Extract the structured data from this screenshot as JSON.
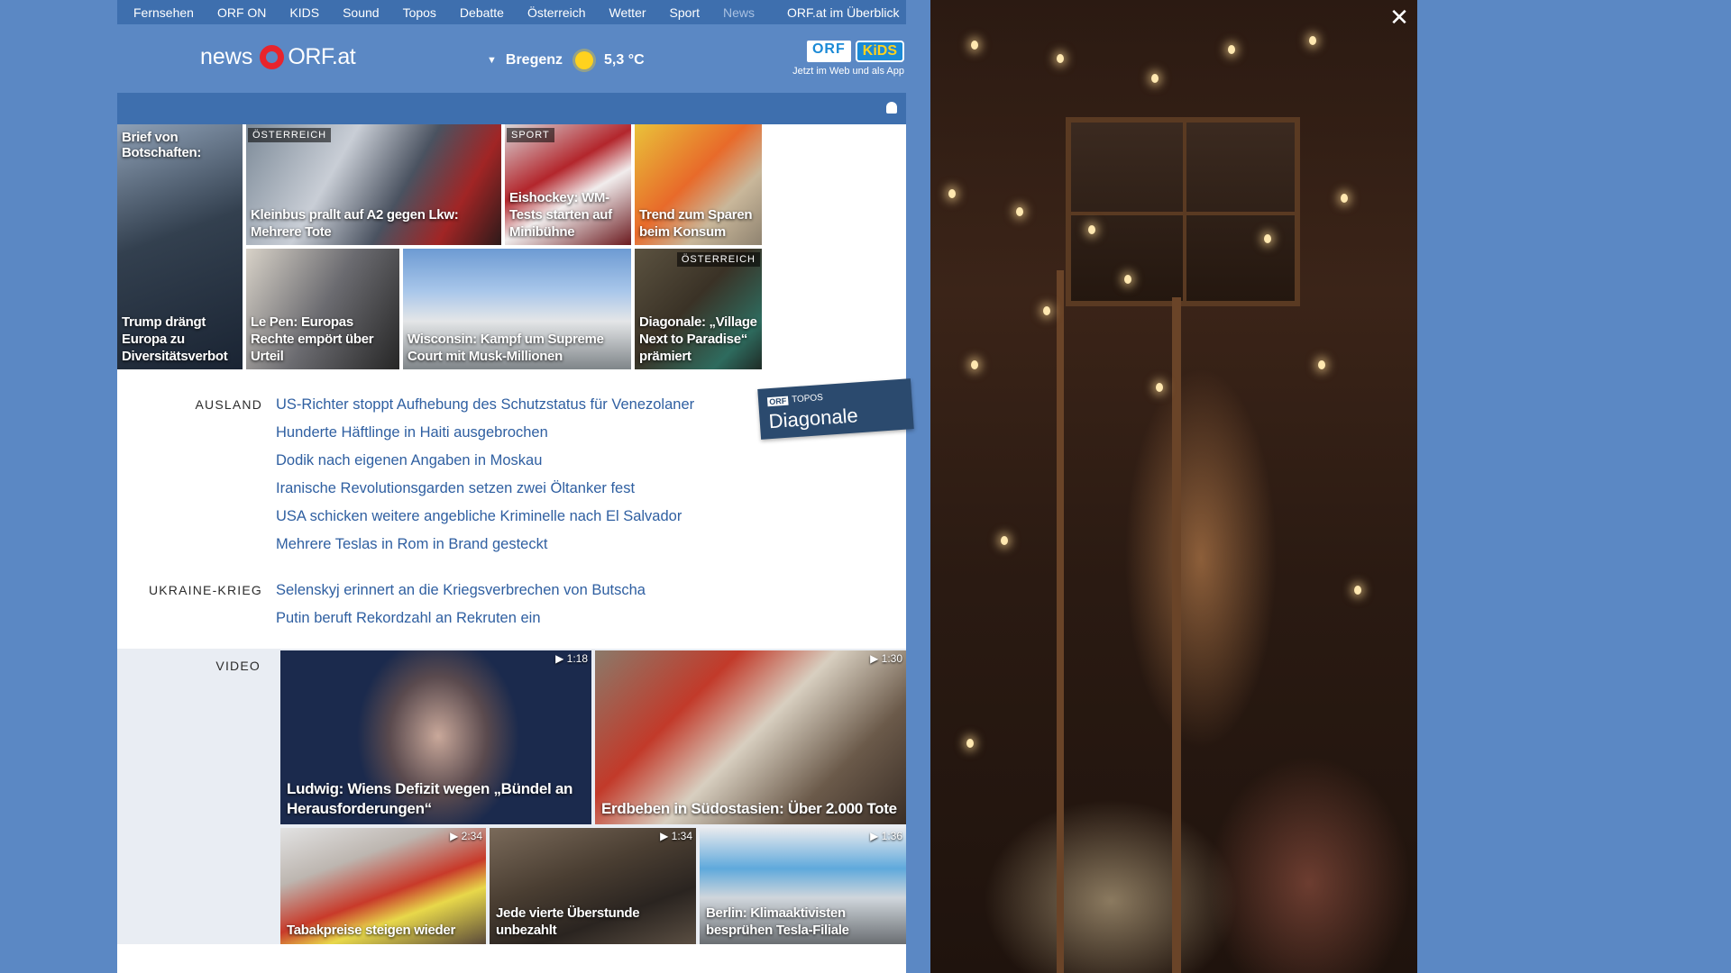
{
  "topnav": [
    "Fernsehen",
    "ORF ON",
    "KIDS",
    "Sound",
    "Topos",
    "Debatte",
    "Österreich",
    "Wetter",
    "Sport",
    "News"
  ],
  "topnav_overview": "ORF.at im Überblick",
  "logo": {
    "news": "news",
    "orfat": "ORF.at"
  },
  "weather": {
    "location": "Bregenz",
    "temperature": "5,3 °C",
    "icon": "sun-icon"
  },
  "kids": {
    "orf": "ORF",
    "kids": "KiDS",
    "sub": "Jetzt im Web und als App"
  },
  "tiles": {
    "t1_top": "Brief von Botschaften:",
    "t1_cap": "Trump drängt Europa zu Diversitätsverbot",
    "t2_tag": "ÖSTERREICH",
    "t2_cap": "Kleinbus prallt auf A2 gegen Lkw: Mehrere Tote",
    "t3_tag": "SPORT",
    "t3_cap": "Eishockey: WM-Tests starten auf Minibühne",
    "t4_cap": "Trend zum Sparen beim Konsum",
    "t5_cap": "Le Pen: Europas Rechte empört über Urteil",
    "t6_cap": "Wisconsin: Kampf um Supreme Court mit Musk-Millionen",
    "t7_tag": "ÖSTERREICH",
    "t7_cap": "Diagonale: „Village Next to Paradise“ prämiert"
  },
  "ausland": {
    "label": "AUSLAND",
    "items": [
      "US-Richter stoppt Aufhebung des Schutzstatus für Venezolaner",
      "Hunderte Häftlinge in Haiti ausgebrochen",
      "Dodik nach eigenen Angaben in Moskau",
      "Iranische Revolutionsgarden setzen zwei Öltanker fest",
      "USA schicken weitere angebliche Kriminelle nach El Salvador",
      "Mehrere Teslas in Rom in Brand gesteckt"
    ]
  },
  "ukraine": {
    "label": "UKRAINE-KRIEG",
    "items": [
      "Selenskyj erinnert an die Kriegsverbrechen von Butscha",
      "Putin beruft Rekordzahl an Rekruten ein"
    ]
  },
  "topos_badge": {
    "orf": "ORF",
    "topos": "TOPOS",
    "title": "Diagonale"
  },
  "video": {
    "label": "VIDEO",
    "items": [
      {
        "dur": "▶ 1:18",
        "cap": "Ludwig: Wiens Defizit wegen „Bündel an Herausforderungen“"
      },
      {
        "dur": "▶ 1:30",
        "cap": "Erdbeben in Südostasien: Über 2.000 Tote"
      },
      {
        "dur": "▶ 2:34",
        "cap": "Tabakpreise steigen wieder"
      },
      {
        "dur": "▶ 1:34",
        "cap": "Jede vierte Überstunde unbezahlt"
      },
      {
        "dur": "▶ 1:36",
        "cap": "Berlin: Klimaaktivisten besprühen Tesla-Filiale"
      }
    ]
  },
  "overlay": {
    "close": "✕"
  }
}
